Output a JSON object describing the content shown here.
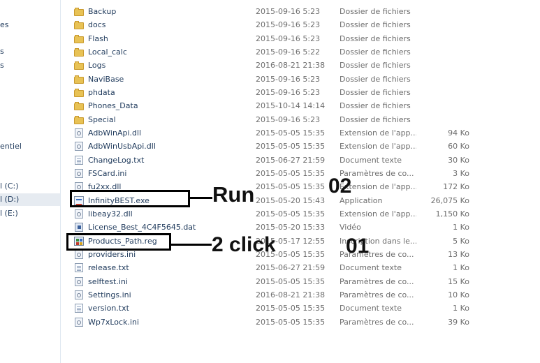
{
  "nav": {
    "items": [
      {
        "label": "es"
      },
      {
        "label": "s"
      },
      {
        "label": "s"
      },
      {
        "label": "entiel"
      },
      {
        "label": "l (C:)"
      },
      {
        "label": "l (D:)"
      },
      {
        "label": "l (E:)"
      }
    ]
  },
  "files": [
    {
      "name": "Backup",
      "date": "2015-09-16 5:23",
      "type": "Dossier de fichiers",
      "size": "",
      "icon": "folder-icon"
    },
    {
      "name": "docs",
      "date": "2015-09-16 5:23",
      "type": "Dossier de fichiers",
      "size": "",
      "icon": "folder-icon"
    },
    {
      "name": "Flash",
      "date": "2015-09-16 5:23",
      "type": "Dossier de fichiers",
      "size": "",
      "icon": "folder-icon"
    },
    {
      "name": "Local_calc",
      "date": "2015-09-16 5:22",
      "type": "Dossier de fichiers",
      "size": "",
      "icon": "folder-icon"
    },
    {
      "name": "Logs",
      "date": "2016-08-21 21:38",
      "type": "Dossier de fichiers",
      "size": "",
      "icon": "folder-icon"
    },
    {
      "name": "NaviBase",
      "date": "2015-09-16 5:23",
      "type": "Dossier de fichiers",
      "size": "",
      "icon": "folder-icon"
    },
    {
      "name": "phdata",
      "date": "2015-09-16 5:23",
      "type": "Dossier de fichiers",
      "size": "",
      "icon": "folder-icon"
    },
    {
      "name": "Phones_Data",
      "date": "2015-10-14 14:14",
      "type": "Dossier de fichiers",
      "size": "",
      "icon": "folder-icon"
    },
    {
      "name": "Special",
      "date": "2015-09-16 5:23",
      "type": "Dossier de fichiers",
      "size": "",
      "icon": "folder-icon"
    },
    {
      "name": "AdbWinApi.dll",
      "date": "2015-05-05 15:35",
      "type": "Extension de l'app...",
      "size": "94 Ko",
      "icon": "dll-icon"
    },
    {
      "name": "AdbWinUsbApi.dll",
      "date": "2015-05-05 15:35",
      "type": "Extension de l'app...",
      "size": "60 Ko",
      "icon": "dll-icon"
    },
    {
      "name": "ChangeLog.txt",
      "date": "2015-06-27 21:59",
      "type": "Document texte",
      "size": "30 Ko",
      "icon": "text-file-icon"
    },
    {
      "name": "FSCard.ini",
      "date": "2015-05-05 15:35",
      "type": "Paramètres de co...",
      "size": "3 Ko",
      "icon": "ini-file-icon"
    },
    {
      "name": "fu2xx.dll",
      "date": "2015-05-05 15:35",
      "type": "Extension de l'app...",
      "size": "172 Ko",
      "icon": "dll-icon"
    },
    {
      "name": "InfinityBEST.exe",
      "date": "2015-05-20 15:43",
      "type": "Application",
      "size": "26,075 Ko",
      "icon": "exe-icon"
    },
    {
      "name": "libeay32.dll",
      "date": "2015-05-05 15:35",
      "type": "Extension de l'app...",
      "size": "1,150 Ko",
      "icon": "dll-icon"
    },
    {
      "name": "License_Best_4C4F5645.dat",
      "date": "2015-05-20 15:33",
      "type": "Vidéo",
      "size": "1 Ko",
      "icon": "video-file-icon"
    },
    {
      "name": "Products_Path.reg",
      "date": "2015-05-17 12:55",
      "type": "Inscription dans le...",
      "size": "5 Ko",
      "icon": "registry-file-icon"
    },
    {
      "name": "providers.ini",
      "date": "2015-05-05 15:35",
      "type": "Paramètres de co...",
      "size": "13 Ko",
      "icon": "ini-file-icon"
    },
    {
      "name": "release.txt",
      "date": "2015-06-27 21:59",
      "type": "Document texte",
      "size": "1 Ko",
      "icon": "text-file-icon"
    },
    {
      "name": "selftest.ini",
      "date": "2015-05-05 15:35",
      "type": "Paramètres de co...",
      "size": "15 Ko",
      "icon": "ini-file-icon"
    },
    {
      "name": "Settings.ini",
      "date": "2016-08-21 21:38",
      "type": "Paramètres de co...",
      "size": "10 Ko",
      "icon": "ini-file-icon"
    },
    {
      "name": "version.txt",
      "date": "2015-05-05 15:35",
      "type": "Document texte",
      "size": "1 Ko",
      "icon": "text-file-icon"
    },
    {
      "name": "Wp7xLock.ini",
      "date": "2015-05-05 15:35",
      "type": "Paramètres de co...",
      "size": "39 Ko",
      "icon": "ini-file-icon"
    }
  ],
  "annotations": {
    "run_label": "Run",
    "run_step": "02",
    "click_label": "2 click",
    "click_step": "01"
  }
}
